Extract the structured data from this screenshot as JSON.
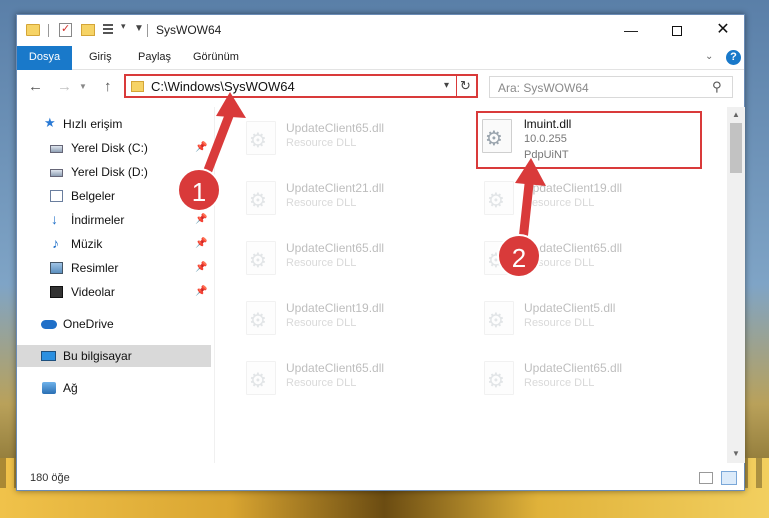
{
  "window": {
    "title": "SysWOW64",
    "minimize_label": "—",
    "close_label": "✕"
  },
  "ribbon": {
    "tabs": [
      {
        "label": "Dosya"
      },
      {
        "label": "Giriş"
      },
      {
        "label": "Paylaş"
      },
      {
        "label": "Görünüm"
      }
    ],
    "help_label": "?"
  },
  "address_bar": {
    "path": "C:\\Windows\\SysWOW64"
  },
  "search": {
    "placeholder": "Ara: SysWOW64"
  },
  "sidebar": {
    "items": [
      {
        "label": "Hızlı erişim",
        "icon": "star-icon"
      },
      {
        "label": "Yerel Disk (C:)",
        "icon": "drive-icon",
        "pinned": true
      },
      {
        "label": "Yerel Disk (D:)",
        "icon": "drive-icon",
        "pinned": false
      },
      {
        "label": "Belgeler",
        "icon": "documents-icon",
        "pinned": true
      },
      {
        "label": "İndirmeler",
        "icon": "download-icon",
        "pinned": true
      },
      {
        "label": "Müzik",
        "icon": "music-icon",
        "pinned": true
      },
      {
        "label": "Resimler",
        "icon": "pictures-icon",
        "pinned": true
      },
      {
        "label": "Videolar",
        "icon": "video-icon",
        "pinned": true
      },
      {
        "label": "OneDrive",
        "icon": "cloud-icon"
      },
      {
        "label": "Bu bilgisayar",
        "icon": "computer-icon",
        "selected": true
      },
      {
        "label": "Ağ",
        "icon": "network-icon"
      }
    ]
  },
  "files": {
    "left_column": [
      {
        "name": "UpdateClient65.dll",
        "desc": "Resource DLL"
      },
      {
        "name": "UpdateClient21.dll",
        "desc": "Resource DLL"
      },
      {
        "name": "UpdateClient65.dll",
        "desc": "Resource DLL"
      },
      {
        "name": "UpdateClient19.dll",
        "desc": "Resource DLL"
      },
      {
        "name": "UpdateClient65.dll",
        "desc": "Resource DLL"
      }
    ],
    "right_column": [
      {
        "name": "UpdateClient19.dll",
        "desc": "Resource DLL"
      },
      {
        "name": "UpdateClient65.dll",
        "desc": "Resource DLL"
      },
      {
        "name": "UpdateClient5.dll",
        "desc": "Resource DLL"
      },
      {
        "name": "UpdateClient65.dll",
        "desc": "Resource DLL"
      }
    ],
    "highlighted": {
      "name": "lmuint.dll",
      "version": "10.0.255",
      "company": "PdpUiNT"
    }
  },
  "status": {
    "item_count": "180 öğe"
  },
  "annotations": {
    "step1": "1",
    "step2": "2",
    "color": "#d93a3a"
  }
}
